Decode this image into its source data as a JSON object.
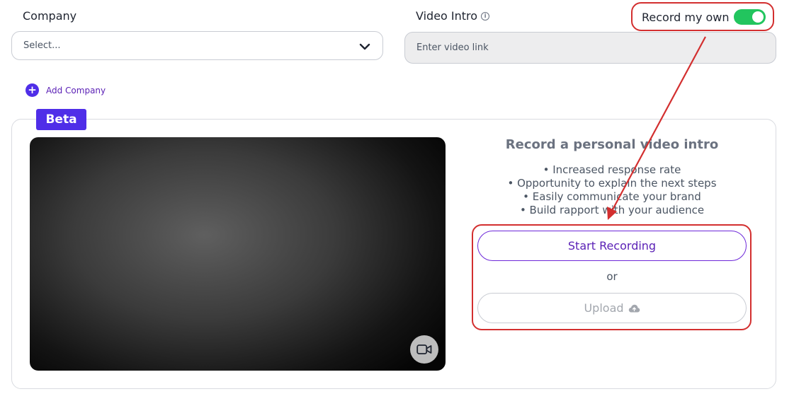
{
  "company": {
    "label": "Company",
    "select_value": "Select..."
  },
  "video_intro": {
    "label": "Video Intro",
    "info_icon": "i",
    "placeholder": "Enter video link"
  },
  "record_own": {
    "label": "Record my own",
    "enabled": true
  },
  "add_company": {
    "icon": "+",
    "label": "Add Company"
  },
  "beta_badge": "Beta",
  "recorder": {
    "heading": "Record a personal video intro",
    "benefits": [
      "• Increased response rate",
      "• Opportunity to explain the next steps",
      "• Easily communicate your brand",
      "• Build rapport with your audience"
    ],
    "start_label": "Start Recording",
    "or_label": "or",
    "upload_label": "Upload"
  },
  "colors": {
    "accent": "#4f2ee8",
    "toggle_on": "#22c55e",
    "annotation": "#d32f2f"
  },
  "icons": [
    "info-icon",
    "chevron-down-icon",
    "plus-icon",
    "video-camera-icon",
    "cloud-upload-icon"
  ]
}
